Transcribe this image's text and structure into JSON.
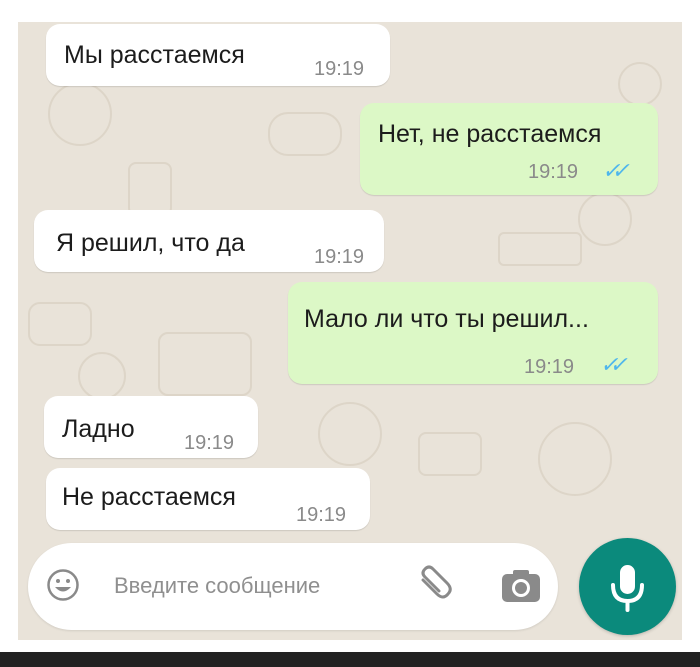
{
  "chat": {
    "messages": [
      {
        "direction": "incoming",
        "text": "Мы расстаемся",
        "time": "19:19"
      },
      {
        "direction": "outgoing",
        "text": "Нет, не расстаемся",
        "time": "19:19",
        "status": "read"
      },
      {
        "direction": "incoming",
        "text": "Я решил, что да",
        "time": "19:19"
      },
      {
        "direction": "outgoing",
        "text": "Мало ли что ты решил...",
        "time": "19:19",
        "status": "read"
      },
      {
        "direction": "incoming",
        "text": "Ладно",
        "time": "19:19"
      },
      {
        "direction": "incoming",
        "text": "Не расстаемся",
        "time": "19:19"
      }
    ]
  },
  "composer": {
    "placeholder": "Введите сообщение",
    "icons": {
      "emoji": "emoji-icon",
      "attach": "paperclip-icon",
      "camera": "camera-icon",
      "mic": "mic-icon"
    }
  },
  "colors": {
    "background": "#e9e3d9",
    "incoming_bubble": "#ffffff",
    "outgoing_bubble": "#dcf8c6",
    "read_ticks": "#4fb6ec",
    "mic_button": "#0b8a7c"
  }
}
